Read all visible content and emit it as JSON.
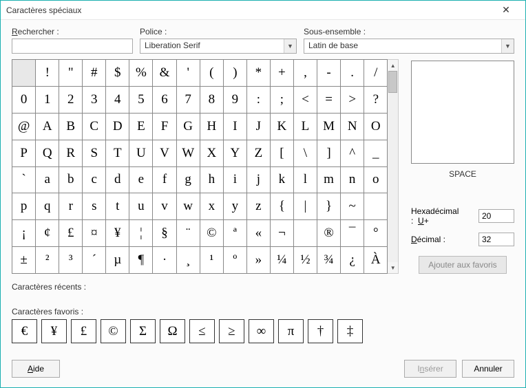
{
  "window": {
    "title": "Caractères spéciaux"
  },
  "fields": {
    "search_label": "Rechercher :",
    "search_value": "",
    "font_label": "Police :",
    "font_value": "Liberation Serif",
    "subset_label": "Sous-ensemble :",
    "subset_value": "Latin de base"
  },
  "grid": {
    "rows": [
      [
        "",
        "!",
        "\"",
        "#",
        "$",
        "%",
        "&",
        "'",
        "(",
        ")",
        "*",
        "+",
        ",",
        "-",
        ".",
        "/"
      ],
      [
        "0",
        "1",
        "2",
        "3",
        "4",
        "5",
        "6",
        "7",
        "8",
        "9",
        ":",
        ";",
        "<",
        "=",
        ">",
        "?"
      ],
      [
        "@",
        "A",
        "B",
        "C",
        "D",
        "E",
        "F",
        "G",
        "H",
        "I",
        "J",
        "K",
        "L",
        "M",
        "N",
        "O"
      ],
      [
        "P",
        "Q",
        "R",
        "S",
        "T",
        "U",
        "V",
        "W",
        "X",
        "Y",
        "Z",
        "[",
        "\\",
        "]",
        "^",
        "_"
      ],
      [
        "`",
        "a",
        "b",
        "c",
        "d",
        "e",
        "f",
        "g",
        "h",
        "i",
        "j",
        "k",
        "l",
        "m",
        "n",
        "o"
      ],
      [
        "p",
        "q",
        "r",
        "s",
        "t",
        "u",
        "v",
        "w",
        "x",
        "y",
        "z",
        "{",
        "|",
        "}",
        "~",
        ""
      ],
      [
        "¡",
        "¢",
        "£",
        "¤",
        "¥",
        "¦",
        "§",
        "¨",
        "©",
        "ª",
        "«",
        "¬",
        "­",
        "®",
        "¯",
        "°"
      ],
      [
        "±",
        "²",
        "³",
        "´",
        "µ",
        "¶",
        "·",
        "¸",
        "¹",
        "º",
        "»",
        "¼",
        "½",
        "¾",
        "¿",
        "À"
      ]
    ],
    "selected": [
      0,
      0
    ]
  },
  "preview": {
    "char": "",
    "name": "SPACE"
  },
  "codes": {
    "hex_label_pre": "Hexadécimal :",
    "hex_label_u": "U",
    "hex_plus": "+",
    "hex_value": "20",
    "dec_label": "Décimal :",
    "dec_value": "32"
  },
  "fav_button": "Ajouter aux favoris",
  "sections": {
    "recent_label": "Caractères récents :",
    "favorites_label": "Caractères favoris :"
  },
  "favorites": [
    "€",
    "¥",
    "£",
    "©",
    "Σ",
    "Ω",
    "≤",
    "≥",
    "∞",
    "π",
    "†",
    "‡"
  ],
  "buttons": {
    "help": "Aide",
    "insert": "Insérer",
    "cancel": "Annuler"
  }
}
